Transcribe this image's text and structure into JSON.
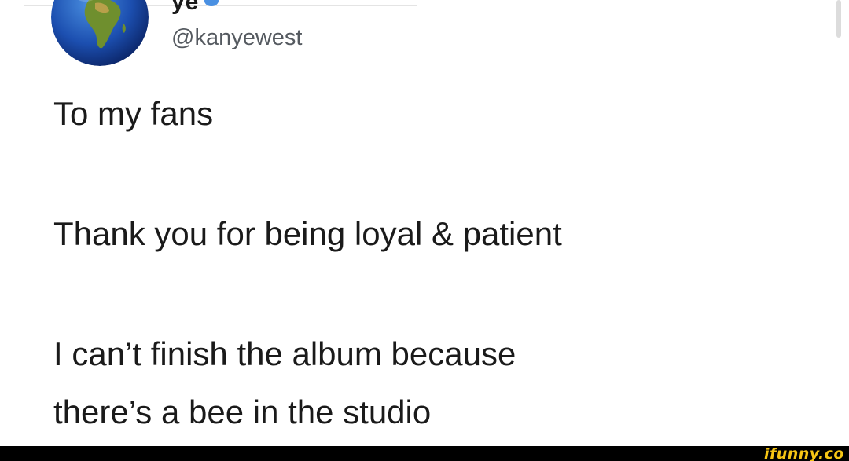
{
  "tweet": {
    "author_name_partial": "ye",
    "handle": "@kanyewest",
    "lines": [
      "To my fans",
      "Thank you for being loyal & patient",
      "I can’t finish the album because",
      "there’s a bee in the studio"
    ]
  },
  "watermark": {
    "text": "ifunny.co"
  },
  "colors": {
    "text": "#1a1a1a",
    "handle": "#555a60",
    "footer": "#000000",
    "watermark": "#f6c514"
  },
  "icons": {
    "avatar": "earth-globe-africa",
    "verified": "verified-badge-icon"
  }
}
